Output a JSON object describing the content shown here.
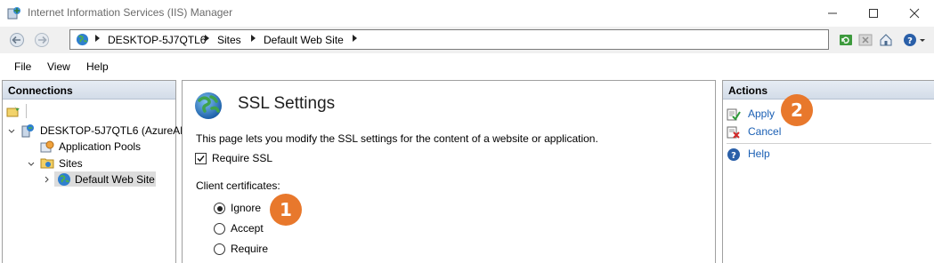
{
  "window": {
    "title": "Internet Information Services (IIS) Manager"
  },
  "address": {
    "crumbs": [
      "DESKTOP-5J7QTL6",
      "Sites",
      "Default Web Site"
    ]
  },
  "menu": {
    "file": "File",
    "view": "View",
    "help": "Help"
  },
  "connections": {
    "header": "Connections",
    "tree": {
      "server": "DESKTOP-5J7QTL6 (AzureADV",
      "app_pools": "Application Pools",
      "sites": "Sites",
      "default_site": "Default Web Site"
    }
  },
  "main": {
    "title": "SSL Settings",
    "description": "This page lets you modify the SSL settings for the content of a website or application.",
    "require_ssl_label": "Require SSL",
    "require_ssl_checked": true,
    "client_cert_label": "Client certificates:",
    "options": [
      {
        "label": "Ignore",
        "selected": true
      },
      {
        "label": "Accept",
        "selected": false
      },
      {
        "label": "Require",
        "selected": false
      }
    ]
  },
  "actions": {
    "header": "Actions",
    "apply": "Apply",
    "cancel": "Cancel",
    "help": "Help"
  },
  "callouts": {
    "one": "1",
    "two": "2"
  },
  "colors": {
    "callout": "#e8782c",
    "link": "#1a5fb4",
    "panel_header": "#dce4ee"
  }
}
